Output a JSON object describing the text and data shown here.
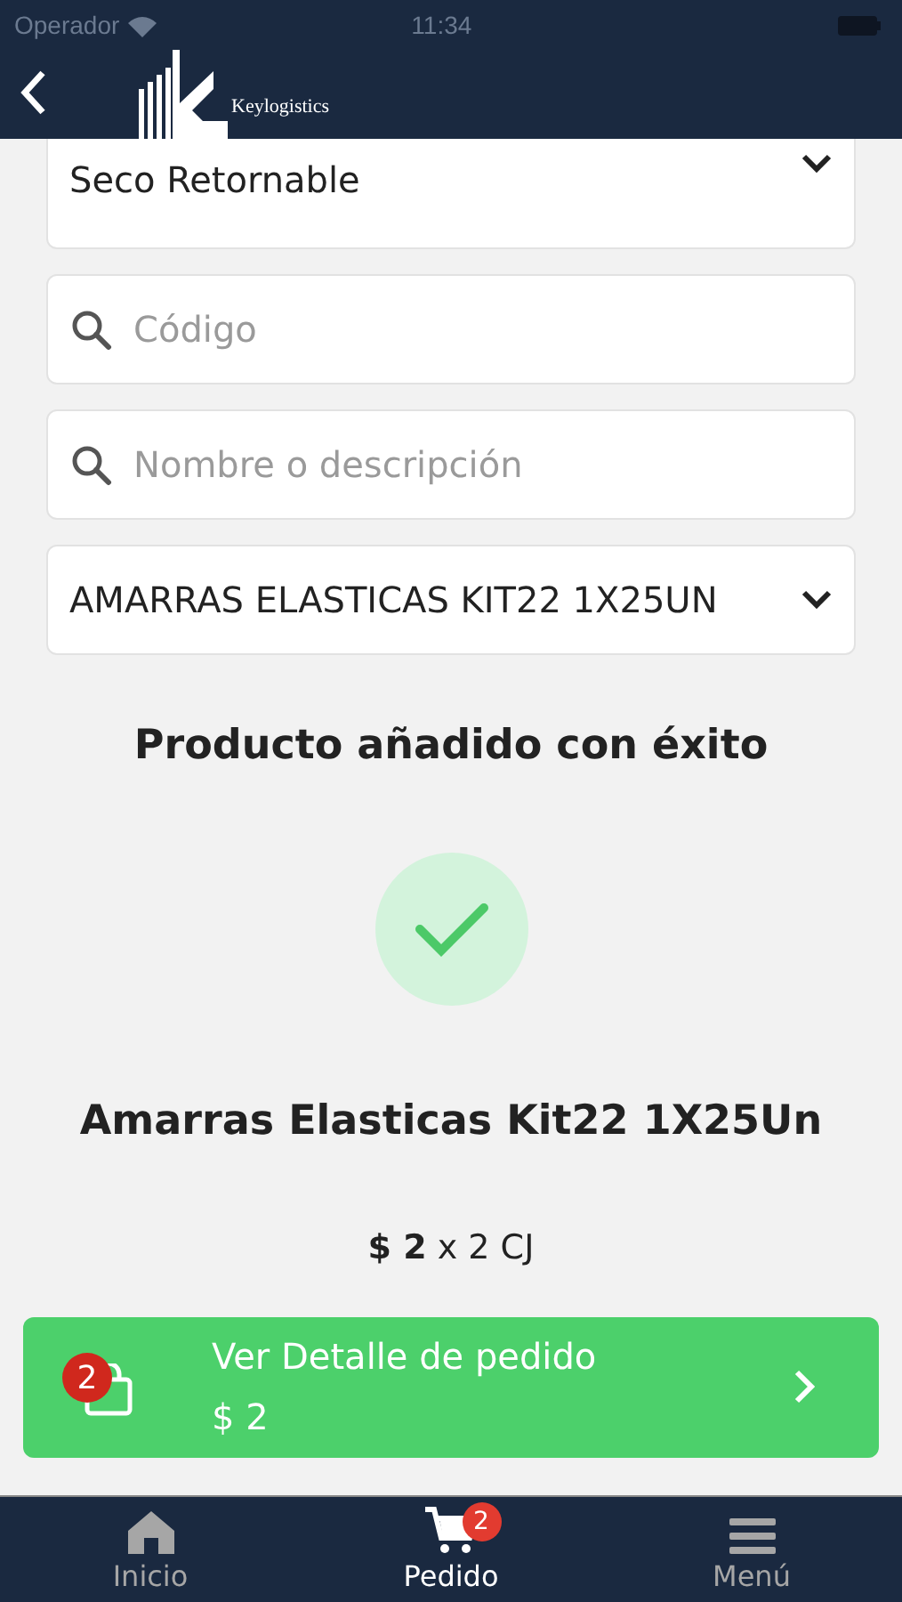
{
  "status_bar": {
    "carrier": "Operador",
    "time": "11:34"
  },
  "header": {
    "brand": "Keylogistics"
  },
  "filters": [
    {
      "kind": "select",
      "value": "Seco Retornable"
    },
    {
      "kind": "search",
      "placeholder": "Código"
    },
    {
      "kind": "search",
      "placeholder": "Nombre o descripción"
    },
    {
      "kind": "select",
      "value": "AMARRAS ELASTICAS KIT22 1X25UN"
    }
  ],
  "message": "Producto añadido con éxito",
  "product": {
    "name": "Amarras Elasticas Kit22 1X25Un",
    "price_line": "**$ 2** x 2 CJ"
  },
  "order_button": {
    "badge": "2",
    "label": "Ver Detalle de pedido",
    "total": "$ 2"
  },
  "tabs": [
    {
      "label": "Inicio",
      "kind": "home",
      "selected": false
    },
    {
      "label": "Pedido",
      "kind": "cart",
      "selected": true,
      "badge": "2"
    },
    {
      "label": "Menú",
      "kind": "menu",
      "selected": false
    }
  ]
}
